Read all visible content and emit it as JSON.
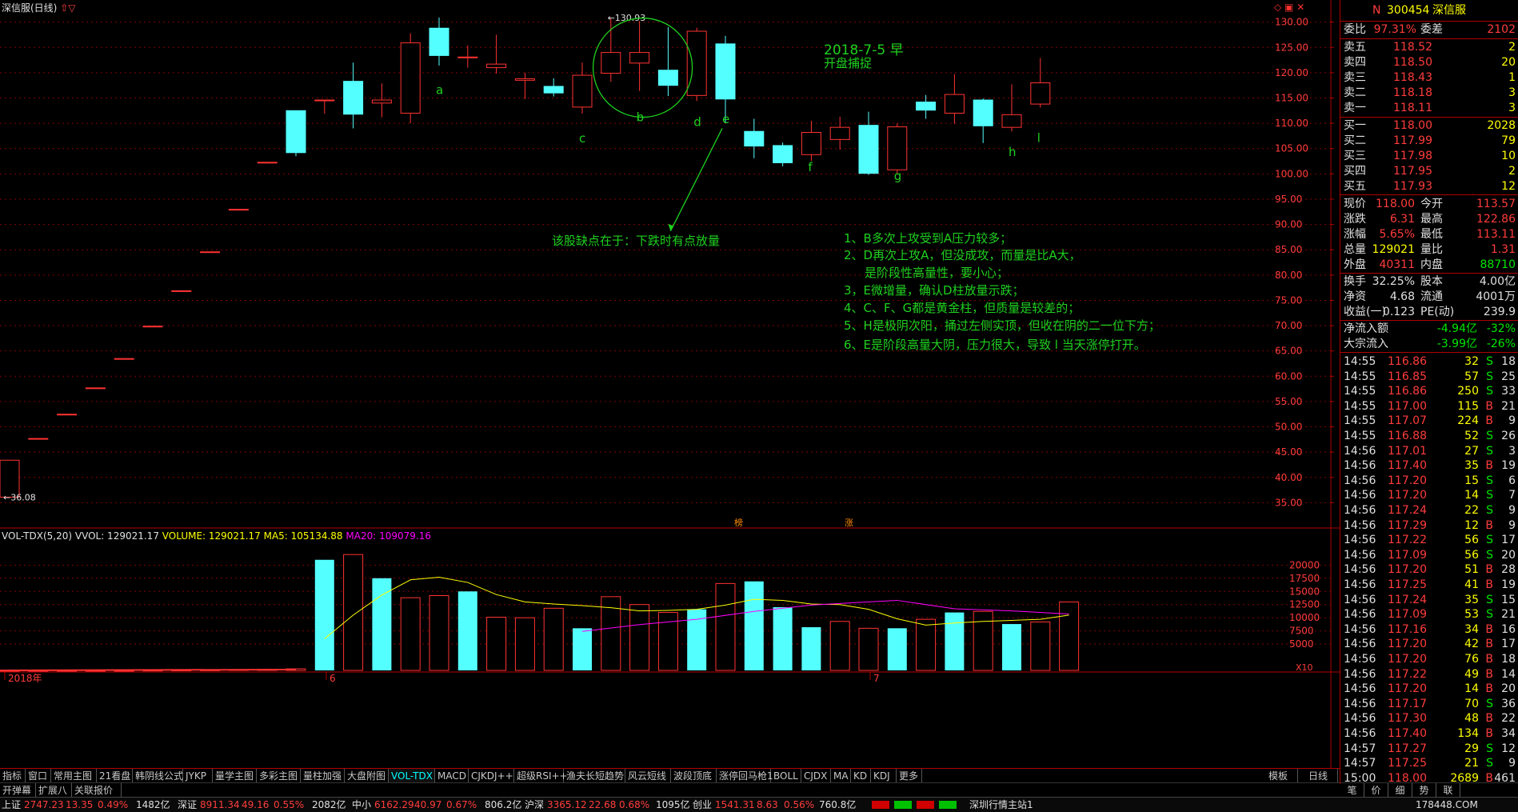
{
  "window": {
    "title": "深信服(日线)",
    "arrows": "⇧▽"
  },
  "chart_data": {
    "type": "candlestick",
    "ylim": [
      30,
      132
    ],
    "y_ticks": [
      "130.00",
      "125.00",
      "120.00",
      "115.00",
      "110.00",
      "105.00",
      "100.00",
      "95.00",
      "90.00",
      "85.00",
      "80.00",
      "75.00",
      "70.00",
      "65.00",
      "60.00",
      "55.00",
      "50.00",
      "45.00",
      "40.00",
      "35.00"
    ],
    "max_label": "130.93",
    "min_label": "36.08",
    "x_labels": [
      "2018年",
      "6",
      "7"
    ],
    "candles": [
      {
        "o": 36.1,
        "h": 43.4,
        "l": 36.1,
        "c": 43.4,
        "up": true
      },
      {
        "o": 47.7,
        "h": 47.7,
        "l": 47.7,
        "c": 47.7,
        "up": true
      },
      {
        "o": 52.5,
        "h": 52.5,
        "l": 52.5,
        "c": 52.5,
        "up": true
      },
      {
        "o": 57.7,
        "h": 57.7,
        "l": 57.7,
        "c": 57.7,
        "up": true
      },
      {
        "o": 63.5,
        "h": 63.5,
        "l": 63.5,
        "c": 63.5,
        "up": true
      },
      {
        "o": 69.9,
        "h": 69.9,
        "l": 69.9,
        "c": 69.9,
        "up": true
      },
      {
        "o": 76.9,
        "h": 76.9,
        "l": 76.9,
        "c": 76.9,
        "up": true
      },
      {
        "o": 84.6,
        "h": 84.6,
        "l": 84.6,
        "c": 84.6,
        "up": true
      },
      {
        "o": 93.0,
        "h": 93.0,
        "l": 93.0,
        "c": 93.0,
        "up": true
      },
      {
        "o": 102.3,
        "h": 102.3,
        "l": 102.3,
        "c": 102.3,
        "up": true
      },
      {
        "o": 112.5,
        "h": 112.5,
        "l": 103.5,
        "c": 104.2,
        "up": false
      },
      {
        "o": 114.6,
        "h": 114.6,
        "l": 111.9,
        "c": 114.6,
        "up": true
      },
      {
        "o": 111.8,
        "h": 122.0,
        "l": 109.0,
        "c": 118.3,
        "up": false
      },
      {
        "o": 114.0,
        "h": 117.9,
        "l": 111.2,
        "c": 114.6,
        "up": true
      },
      {
        "o": 112.0,
        "h": 127.8,
        "l": 110.0,
        "c": 125.9,
        "up": true
      },
      {
        "o": 128.8,
        "h": 130.9,
        "l": 121.4,
        "c": 123.4,
        "up": false
      },
      {
        "o": 123.1,
        "h": 125.4,
        "l": 121.0,
        "c": 123.1,
        "up": true
      },
      {
        "o": 121.0,
        "h": 127.5,
        "l": 119.8,
        "c": 121.7,
        "up": true
      },
      {
        "o": 118.8,
        "h": 120.0,
        "l": 114.8,
        "c": 118.5,
        "up": true
      },
      {
        "o": 117.3,
        "h": 118.9,
        "l": 115.3,
        "c": 116.0,
        "up": false
      },
      {
        "o": 113.2,
        "h": 122.0,
        "l": 111.9,
        "c": 119.5,
        "up": true
      },
      {
        "o": 119.9,
        "h": 130.9,
        "l": 118.2,
        "c": 124.0,
        "up": true
      },
      {
        "o": 121.9,
        "h": 130.2,
        "l": 116.4,
        "c": 124.0,
        "up": true
      },
      {
        "o": 120.5,
        "h": 129.0,
        "l": 115.4,
        "c": 117.5,
        "up": false
      },
      {
        "o": 115.5,
        "h": 128.9,
        "l": 114.4,
        "c": 128.2,
        "up": true
      },
      {
        "o": 125.7,
        "h": 127.3,
        "l": 110.0,
        "c": 114.8,
        "up": false
      },
      {
        "o": 108.4,
        "h": 110.9,
        "l": 103.1,
        "c": 105.5,
        "up": false
      },
      {
        "o": 105.6,
        "h": 106.2,
        "l": 101.5,
        "c": 102.2,
        "up": false
      },
      {
        "o": 103.8,
        "h": 110.5,
        "l": 102.6,
        "c": 108.2,
        "up": true
      },
      {
        "o": 106.8,
        "h": 111.3,
        "l": 104.8,
        "c": 109.2,
        "up": true
      },
      {
        "o": 109.6,
        "h": 112.3,
        "l": 99.8,
        "c": 100.1,
        "up": false
      },
      {
        "o": 100.8,
        "h": 110.0,
        "l": 99.9,
        "c": 109.3,
        "up": true
      },
      {
        "o": 114.2,
        "h": 115.6,
        "l": 110.9,
        "c": 112.6,
        "up": false
      },
      {
        "o": 112.0,
        "h": 119.7,
        "l": 109.9,
        "c": 115.7,
        "up": true
      },
      {
        "o": 114.6,
        "h": 114.9,
        "l": 106.1,
        "c": 109.5,
        "up": false
      },
      {
        "o": 109.2,
        "h": 117.7,
        "l": 108.4,
        "c": 111.7,
        "up": true
      },
      {
        "o": 113.8,
        "h": 122.9,
        "l": 113.1,
        "c": 118.0,
        "up": true
      }
    ],
    "candle_labels": [
      {
        "text": "a",
        "i": 15,
        "v": 115.8
      },
      {
        "text": "c",
        "i": 20,
        "v": 106.2
      },
      {
        "text": "b",
        "i": 22,
        "v": 110.4
      },
      {
        "text": "d",
        "i": 24,
        "v": 109.5
      },
      {
        "text": "e",
        "i": 25,
        "v": 110.0
      },
      {
        "text": "f",
        "i": 28,
        "v": 100.5
      },
      {
        "text": "g",
        "i": 31,
        "v": 98.8
      },
      {
        "text": "h",
        "i": 35,
        "v": 103.5
      },
      {
        "text": "l",
        "i": 36,
        "v": 106.3
      }
    ],
    "volume": {
      "header": {
        "label": "VOL-TDX(5,20)",
        "vvol": "VVOL: 129021.17",
        "volume": "VOLUME: 129021.17",
        "ma5": "MA5: 105134.88",
        "ma20": "MA20: 109079.16"
      },
      "ylim": [
        0,
        24000
      ],
      "y_ticks": [
        "20000",
        "17500",
        "15000",
        "12500",
        "10000",
        "7500",
        "5000"
      ],
      "x10": "X10",
      "values": [
        1,
        1,
        1,
        1,
        1,
        50,
        80,
        100,
        150,
        200,
        300,
        21000,
        22000,
        17500,
        13800,
        14200,
        15000,
        10100,
        10000,
        11800,
        8000,
        14000,
        12500,
        11000,
        11600,
        16500,
        16900,
        12000,
        8200,
        9300,
        8000,
        8000,
        9700,
        11000,
        11200,
        8800,
        9200,
        13000
      ],
      "up": [
        true,
        true,
        true,
        true,
        true,
        true,
        true,
        true,
        true,
        true,
        true,
        false,
        true,
        false,
        true,
        true,
        false,
        true,
        true,
        true,
        false,
        true,
        true,
        true,
        false,
        true,
        false,
        false,
        false,
        true,
        true,
        false,
        true,
        false,
        true,
        false,
        true,
        true
      ],
      "ma5": [
        [
          11,
          6000
        ],
        [
          12,
          10500
        ],
        [
          13,
          14300
        ],
        [
          14,
          17200
        ],
        [
          15,
          17700
        ],
        [
          16,
          16700
        ],
        [
          17,
          14400
        ],
        [
          18,
          13000
        ],
        [
          19,
          12600
        ],
        [
          20,
          12300
        ],
        [
          21,
          11900
        ],
        [
          22,
          11300
        ],
        [
          23,
          11400
        ],
        [
          24,
          11600
        ],
        [
          25,
          12400
        ],
        [
          26,
          13500
        ],
        [
          27,
          13300
        ],
        [
          28,
          12600
        ],
        [
          29,
          12500
        ],
        [
          30,
          11600
        ],
        [
          31,
          9800
        ],
        [
          32,
          8600
        ],
        [
          33,
          9000
        ],
        [
          34,
          9300
        ],
        [
          35,
          9500
        ],
        [
          36,
          9700
        ],
        [
          37,
          10500
        ]
      ],
      "ma20": [
        [
          20,
          7400
        ],
        [
          22,
          8700
        ],
        [
          24,
          9700
        ],
        [
          26,
          11200
        ],
        [
          28,
          12400
        ],
        [
          30,
          13000
        ],
        [
          31,
          13300
        ],
        [
          33,
          11700
        ],
        [
          35,
          11300
        ],
        [
          37,
          10700
        ]
      ]
    }
  },
  "annotations": {
    "date": "2018-7-5 早",
    "capture": "开盘捕捉",
    "flaw": "该股缺点在于：下跌时有点放量",
    "points": [
      "1、B多次上攻受到A压力较多；",
      "2、D再次上攻A，但没成攻，而量是比A大，",
      "是阶段性高量性，要小心；",
      "3，E微增量，确认D柱放量示跌；",
      "4、C、F、G都是黄金柱，但质量是较差的；",
      "5、H是极阴次阳，捅过左侧实顶，但收在阴的二一位下方；",
      "6、E是阶段高量大阴，压力很大，导致 l 当天涨停打开。"
    ],
    "marker1": "榜",
    "marker2": "涨"
  },
  "quote": {
    "badge": "N",
    "code": "300454",
    "name": "深信服",
    "weibi_label": "委比",
    "weibi": "97.31%",
    "weicha_label": "委差",
    "weicha": "2102",
    "sells": [
      {
        "label": "卖五",
        "price": "118.52",
        "vol": "2"
      },
      {
        "label": "卖四",
        "price": "118.50",
        "vol": "20"
      },
      {
        "label": "卖三",
        "price": "118.43",
        "vol": "1"
      },
      {
        "label": "卖二",
        "price": "118.18",
        "vol": "3"
      },
      {
        "label": "卖一",
        "price": "118.11",
        "vol": "3"
      }
    ],
    "buys": [
      {
        "label": "买一",
        "price": "118.00",
        "vol": "2028"
      },
      {
        "label": "买二",
        "price": "117.99",
        "vol": "79"
      },
      {
        "label": "买三",
        "price": "117.98",
        "vol": "10"
      },
      {
        "label": "买四",
        "price": "117.95",
        "vol": "2"
      },
      {
        "label": "买五",
        "price": "117.93",
        "vol": "12"
      }
    ],
    "stats": [
      {
        "l1": "现价",
        "v1": "118.00",
        "l2": "今开",
        "v2": "113.57",
        "c1": "red",
        "c2": "red"
      },
      {
        "l1": "涨跌",
        "v1": "6.31",
        "l2": "最高",
        "v2": "122.86",
        "c1": "red",
        "c2": "red"
      },
      {
        "l1": "涨幅",
        "v1": "5.65%",
        "l2": "最低",
        "v2": "113.11",
        "c1": "red",
        "c2": "red"
      },
      {
        "l1": "总量",
        "v1": "129021",
        "l2": "量比",
        "v2": "1.31",
        "c1": "yel",
        "c2": "red"
      },
      {
        "l1": "外盘",
        "v1": "40311",
        "l2": "内盘",
        "v2": "88710",
        "c1": "red",
        "c2": "grn"
      }
    ],
    "stats2": [
      {
        "l1": "换手",
        "v1": "32.25%",
        "l2": "股本",
        "v2": "4.00亿"
      },
      {
        "l1": "净资",
        "v1": "4.68",
        "l2": "流通",
        "v2": "4001万"
      },
      {
        "l1": "收益(一)",
        "v1": "0.123",
        "l2": "PE(动)",
        "v2": "239.9"
      }
    ],
    "flows": [
      {
        "label": "净流入额",
        "v1": "-4.94亿",
        "v2": "-32%"
      },
      {
        "label": "大宗流入",
        "v1": "-3.99亿",
        "v2": "-26%"
      }
    ]
  },
  "ticks": [
    [
      "14:55",
      "116.86",
      "32",
      "S",
      "18"
    ],
    [
      "14:55",
      "116.85",
      "57",
      "S",
      "25"
    ],
    [
      "14:55",
      "116.86",
      "250",
      "S",
      "33"
    ],
    [
      "14:55",
      "117.00",
      "115",
      "B",
      "21"
    ],
    [
      "14:55",
      "117.07",
      "224",
      "B",
      "9"
    ],
    [
      "14:55",
      "116.88",
      "52",
      "S",
      "26"
    ],
    [
      "14:56",
      "117.01",
      "27",
      "S",
      "3"
    ],
    [
      "14:56",
      "117.40",
      "35",
      "B",
      "19"
    ],
    [
      "14:56",
      "117.20",
      "15",
      "S",
      "6"
    ],
    [
      "14:56",
      "117.20",
      "14",
      "S",
      "7"
    ],
    [
      "14:56",
      "117.24",
      "22",
      "S",
      "9"
    ],
    [
      "14:56",
      "117.29",
      "12",
      "B",
      "9"
    ],
    [
      "14:56",
      "117.22",
      "56",
      "S",
      "17"
    ],
    [
      "14:56",
      "117.09",
      "56",
      "S",
      "20"
    ],
    [
      "14:56",
      "117.20",
      "51",
      "B",
      "28"
    ],
    [
      "14:56",
      "117.25",
      "41",
      "B",
      "19"
    ],
    [
      "14:56",
      "117.24",
      "35",
      "S",
      "15"
    ],
    [
      "14:56",
      "117.09",
      "53",
      "S",
      "21"
    ],
    [
      "14:56",
      "117.16",
      "34",
      "B",
      "16"
    ],
    [
      "14:56",
      "117.20",
      "42",
      "B",
      "17"
    ],
    [
      "14:56",
      "117.20",
      "76",
      "B",
      "18"
    ],
    [
      "14:56",
      "117.22",
      "49",
      "B",
      "14"
    ],
    [
      "14:56",
      "117.20",
      "14",
      "B",
      "20"
    ],
    [
      "14:56",
      "117.17",
      "70",
      "S",
      "36"
    ],
    [
      "14:56",
      "117.30",
      "48",
      "B",
      "22"
    ],
    [
      "14:56",
      "117.40",
      "134",
      "B",
      "34"
    ],
    [
      "14:57",
      "117.27",
      "29",
      "S",
      "12"
    ],
    [
      "14:57",
      "117.25",
      "21",
      "S",
      "9"
    ],
    [
      "15:00",
      "118.00",
      "2689",
      "B",
      "461"
    ]
  ],
  "tabs": [
    "指标",
    "窗口",
    "常用主图",
    "21看盘",
    "韩阴线公式",
    "JYKP",
    "量学主图",
    "多彩主图",
    "量柱加强",
    "大盘附图",
    "VOL-TDX",
    "MACD",
    "CJKDJ++",
    "超级RSI++",
    "渔夫长短趋势",
    "风云短线",
    "波段顶底",
    "涨停回马枪1",
    "BOLL",
    "CJDX",
    "MA",
    "KD",
    "KDJ",
    "更多"
  ],
  "active_tab": "VOL-TDX",
  "tabs_right": [
    "模板",
    "日线"
  ],
  "row2_tabs": [
    "开弹幕",
    "扩展八",
    "关联报价"
  ],
  "rp_bottom_tabs": [
    "笔",
    "价",
    "细",
    "势",
    "联"
  ],
  "status": {
    "sh_label": "上证",
    "sh_v": "2747.23",
    "sh_c": "13.35",
    "sh_p": "0.49%",
    "sh_a": "1482亿",
    "sz_label": "深证",
    "sz_v": "8911.34",
    "sz_c": "49.16",
    "sz_p": "0.55%",
    "sz_a": "2082亿",
    "zx_label": "中小",
    "zx_v": "6162.29",
    "zx_c": "40.97",
    "zx_p": "0.67%",
    "zx_a": "806.2亿",
    "hs_label": "沪深",
    "hs_v": "3365.12",
    "hs_c": "22.68",
    "hs_p": "0.68%",
    "hs_a": "1095亿",
    "cy_label": "创业",
    "cy_v": "1541.31",
    "cy_c": "8.63",
    "cy_p": "0.56%",
    "cy_a": "760.8亿",
    "station": "深圳行情主站1",
    "watermark": "178448.COM"
  }
}
